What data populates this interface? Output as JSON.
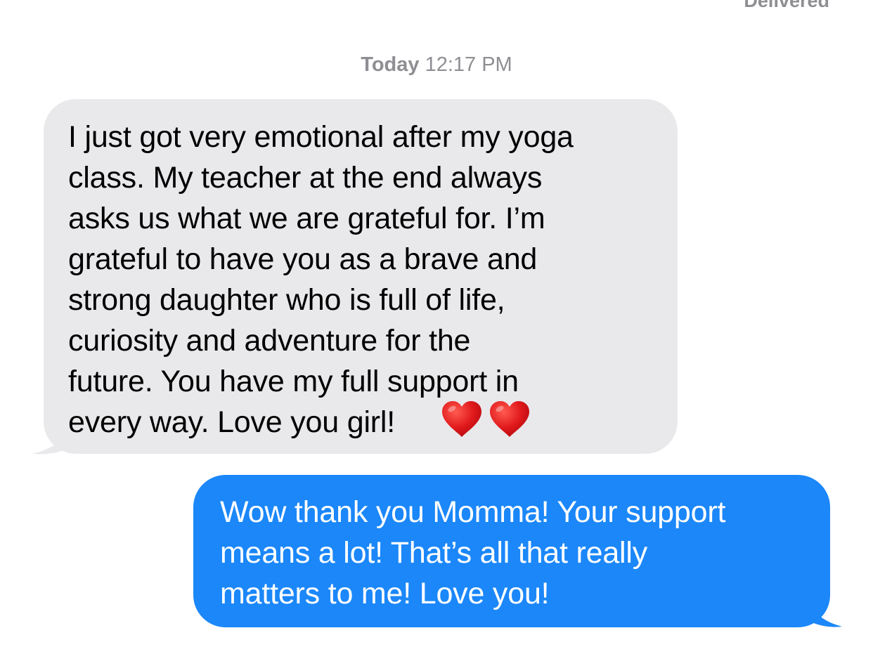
{
  "status": {
    "delivered_label": "Delivered"
  },
  "timestamp": {
    "day": "Today",
    "time": "12:17 PM"
  },
  "messages": [
    {
      "direction": "incoming",
      "text": "I just got very emotional after my yoga\nclass. My teacher at the end always\nasks us what we are grateful for. I’m\ngrateful to have you as a brave and\nstrong  daughter who is full of life,\ncuriosity and  adventure for the\nfuture. You have my full support in\nevery way. Love you girl!",
      "emoji": [
        "heart-emoji",
        "heart-emoji"
      ],
      "bubble_color": "#e9e9eb",
      "text_color": "#000000"
    },
    {
      "direction": "outgoing",
      "text": "Wow thank you Momma! Your support\nmeans a lot! That’s all that really\nmatters to me! Love you!",
      "bubble_color": "#1b87f9",
      "text_color": "#ffffff"
    }
  ],
  "colors": {
    "meta_text": "#8e8e93",
    "background": "#ffffff"
  }
}
